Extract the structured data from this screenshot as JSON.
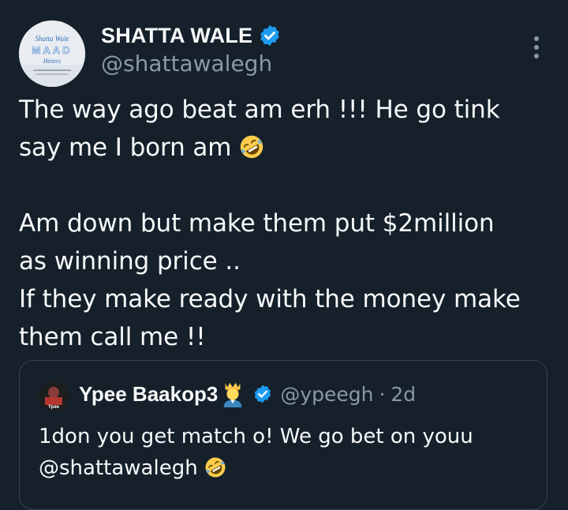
{
  "author": {
    "display_name": "SHATTA WALE",
    "handle": "@shattawalegh",
    "avatar_text_top": "Shatta Wale",
    "avatar_text_mid": "MAAD",
    "avatar_text_bottom": "Hitters"
  },
  "tweet": {
    "line1": "The way ago beat am erh !!! He go tink",
    "line2": "say me I born am",
    "line3": "",
    "line4": "Am down but make them put $2million",
    "line5": "as winning price ..",
    "line6": "If they make ready with the money make",
    "line7": "them call me !!"
  },
  "quote": {
    "display_name": "Ypee Baakop3",
    "handle": "@ypeegh",
    "separator": "·",
    "time": "2d",
    "avatar_text": "Ypee",
    "line1": "1don you get match o! We go bet on youu",
    "line2": "@shattawalegh"
  },
  "colors": {
    "background": "#15202b",
    "text": "#f7f9f9",
    "muted": "#8b98a5",
    "verified": "#1d9bf0",
    "border": "#38444d"
  },
  "icons": {
    "verified": "verified-badge-icon",
    "more": "more-vertical-icon",
    "emoji": "rolling-on-floor-laughing-emoji",
    "crown": "prince-emoji"
  }
}
